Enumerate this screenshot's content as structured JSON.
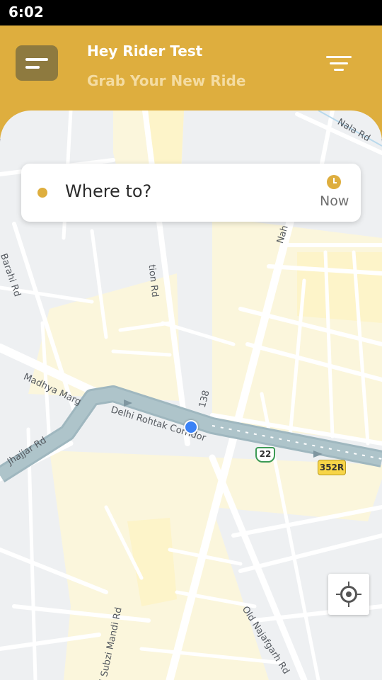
{
  "status_bar": {
    "time": "6:02"
  },
  "header": {
    "greeting": "Hey Rider Test",
    "subtitle": "Grab Your New Ride"
  },
  "search": {
    "placeholder": "Where to?",
    "schedule_label": "Now"
  },
  "map": {
    "road_labels": [
      "Nala Rd",
      "tion Rd",
      "Nah",
      "Barahi Rd",
      "Madhya Marg",
      "Delhi Rohtak Corridor",
      "138",
      "Jhajjar Rd",
      "Old Najafgarh Rd",
      "d Subzi Mandi Rd"
    ],
    "shields": [
      "22",
      "352R"
    ]
  },
  "colors": {
    "accent": "#deae3e",
    "menu_button": "#8e7a3f",
    "location_dot": "#3b82f6",
    "corridor": "#a9c1c8"
  }
}
